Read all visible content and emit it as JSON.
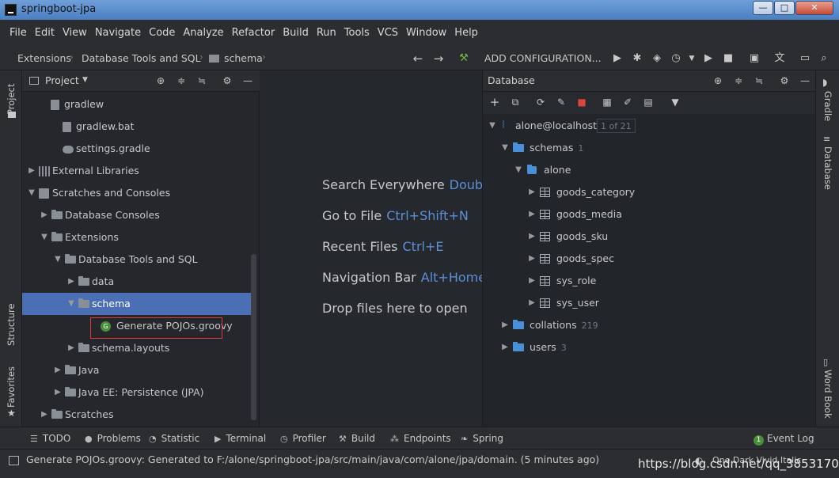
{
  "window": {
    "title": "springboot-jpa",
    "minimize": "—",
    "maximize": "□",
    "close": "✕"
  },
  "menu": [
    "File",
    "Edit",
    "View",
    "Navigate",
    "Code",
    "Analyze",
    "Refactor",
    "Build",
    "Run",
    "Tools",
    "VCS",
    "Window",
    "Help"
  ],
  "navbar": {
    "breadcrumbs": [
      "Extensions",
      "Database Tools and SQL",
      "schema"
    ],
    "run_config": "ADD CONFIGURATION..."
  },
  "left_stripe": {
    "project": "Project",
    "structure": "Structure",
    "favorites": "Favorites"
  },
  "project": {
    "header": "Project",
    "rows": [
      {
        "label": "gradlew",
        "type": "file"
      },
      {
        "label": "gradlew.bat",
        "type": "file"
      },
      {
        "label": "settings.gradle",
        "type": "gradle"
      },
      {
        "label": "External Libraries",
        "type": "lib"
      },
      {
        "label": "Scratches and Consoles",
        "type": "scratch"
      },
      {
        "label": "Database Consoles",
        "type": "folder"
      },
      {
        "label": "Extensions",
        "type": "folder"
      },
      {
        "label": "Database Tools and SQL",
        "type": "folder"
      },
      {
        "label": "data",
        "type": "folder"
      },
      {
        "label": "schema",
        "type": "folder"
      },
      {
        "label": "Generate POJOs.groovy",
        "type": "groovy"
      },
      {
        "label": "schema.layouts",
        "type": "folder"
      },
      {
        "label": "Java",
        "type": "folder"
      },
      {
        "label": "Java EE: Persistence (JPA)",
        "type": "folder"
      },
      {
        "label": "Scratches",
        "type": "folder"
      }
    ]
  },
  "editor_hints": [
    {
      "text": "Search Everywhere",
      "key": "Double"
    },
    {
      "text": "Go to File",
      "key": "Ctrl+Shift+N"
    },
    {
      "text": "Recent Files",
      "key": "Ctrl+E"
    },
    {
      "text": "Navigation Bar",
      "key": "Alt+Home"
    },
    {
      "text": "Drop files here to open",
      "key": ""
    }
  ],
  "database": {
    "header": "Database",
    "connection": "alone@localhost",
    "connection_badge": "1 of 21",
    "schemas_label": "schemas",
    "schemas_count": "1",
    "schema_name": "alone",
    "tables": [
      "goods_category",
      "goods_media",
      "goods_sku",
      "goods_spec",
      "sys_role",
      "sys_user"
    ],
    "collations_label": "collations",
    "collations_count": "219",
    "users_label": "users",
    "users_count": "3"
  },
  "right_stripe": {
    "gradle": "Gradle",
    "database": "Database",
    "wordbook": "Word Book"
  },
  "bottom_tools": [
    "TODO",
    "Problems",
    "Statistic",
    "Terminal",
    "Profiler",
    "Build",
    "Endpoints",
    "Spring",
    "Event Log"
  ],
  "event_badge": "1",
  "status": {
    "message": "Generate POJOs.groovy: Generated to F:/alone/springboot-jpa/src/main/java/com/alone/jpa/domain. (5 minutes ago)",
    "theme": "One Dark Vivid Italic",
    "watermark": "https://blog.csdn.net/qq_38531706"
  }
}
